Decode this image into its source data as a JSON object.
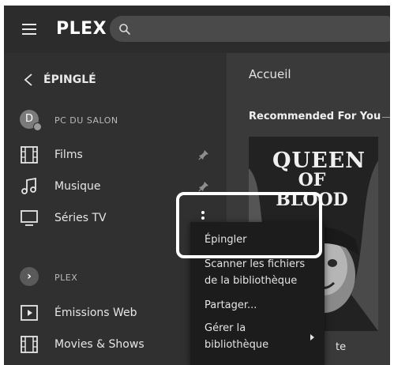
{
  "topbar": {
    "logo_main": "PLEX",
    "logo_accent": "",
    "search_placeholder": ""
  },
  "sidebar": {
    "back_label": "ÉPINGLÉ",
    "server_label": "PC DU SALON",
    "avatar_letter": "D",
    "items": [
      {
        "label": "Films",
        "icon": "film-icon",
        "pinned": true
      },
      {
        "label": "Musique",
        "icon": "music-icon",
        "pinned": true
      },
      {
        "label": "Séries TV",
        "icon": "tv-icon",
        "pinned": false
      }
    ],
    "plex_section_label": "PLEX",
    "plex_items": [
      {
        "label": "Émissions Web",
        "icon": "play-box-icon"
      },
      {
        "label": "Movies & Shows",
        "icon": "film-icon"
      }
    ]
  },
  "main": {
    "title": "Accueil",
    "section_title": "Recommended For You",
    "poster": {
      "title_line1": "QUEEN",
      "title_line2": "OF BLOOD",
      "caption": "te"
    }
  },
  "context_menu": {
    "items": [
      {
        "label": "Épingler"
      },
      {
        "label": "Scanner les fichiers de la bibliothèque"
      },
      {
        "label": "Partager..."
      },
      {
        "label": "Gérer la bibliothèque",
        "has_submenu": true
      }
    ]
  },
  "colors": {
    "topbar_bg": "#2c2c2c",
    "sidebar_bg": "#303030",
    "main_bg": "#3a3a3a",
    "menu_bg": "#1c1c1c",
    "highlight": "#ffffff"
  }
}
